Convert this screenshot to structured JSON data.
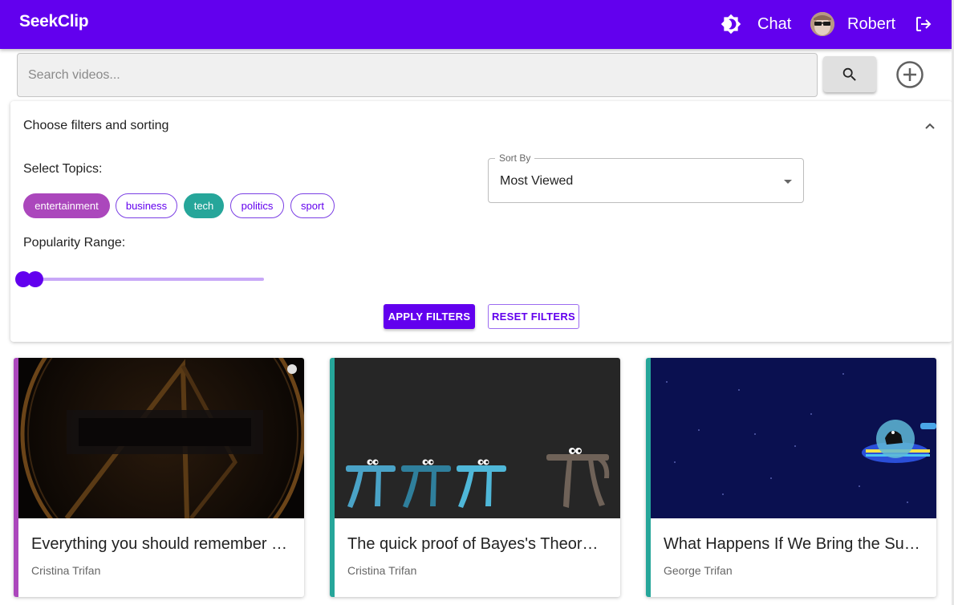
{
  "app": {
    "logo": "SeekClip"
  },
  "header": {
    "chat_label": "Chat",
    "user_name": "Robert",
    "icons": [
      "theme-toggle-icon",
      "avatar",
      "logout-icon"
    ]
  },
  "search": {
    "placeholder": "Search videos...",
    "value": ""
  },
  "filters": {
    "title": "Choose filters and sorting",
    "topics_label": "Select Topics:",
    "topics": [
      {
        "label": "entertainment",
        "selected": true,
        "color": "#ab47bc"
      },
      {
        "label": "business",
        "selected": false
      },
      {
        "label": "tech",
        "selected": true,
        "color": "#26a69a"
      },
      {
        "label": "politics",
        "selected": false
      },
      {
        "label": "sport",
        "selected": false
      }
    ],
    "sort_legend": "Sort By",
    "sort_value": "Most Viewed",
    "popularity_label": "Popularity Range:",
    "popularity_range": [
      0,
      0.08
    ],
    "apply_label": "APPLY FILTERS",
    "reset_label": "RESET FILTERS"
  },
  "colors": {
    "primary": "#6200ee",
    "entertainment": "#ab47bc",
    "tech": "#26a69a"
  },
  "videos": [
    {
      "title": "Everything you should remember …",
      "author": "Cristina Trifan",
      "topic_color": "#ab47bc"
    },
    {
      "title": "The quick proof of Bayes's Theore…",
      "author": "Cristina Trifan",
      "topic_color": "#26a69a"
    },
    {
      "title": "What Happens If We Bring the Su…",
      "author": "George Trifan",
      "topic_color": "#26a69a"
    }
  ]
}
